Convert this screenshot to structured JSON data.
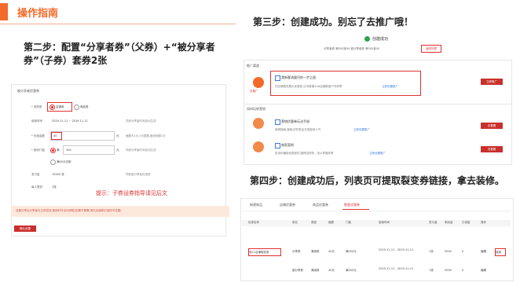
{
  "header": {
    "title": "操作指南"
  },
  "step2": {
    "text": "第二步：配置“分享者券”（父券）+“被分享者券”（子券）套券2张"
  },
  "left_form": {
    "title": "被分享者优惠券",
    "rows": [
      {
        "label": "* 券类型",
        "opt1": "店铺券",
        "opt2": "商品券"
      },
      {
        "label": "使用时间",
        "value": "2019-11-11 ~ 2019-11-11",
        "tip": "同到分享者时间自动生成"
      },
      {
        "label": "* 优惠金额",
        "value": "40",
        "unit": "元",
        "tip": "面额为1元,0元整数,最低面额1元"
      },
      {
        "label": "* 使用门槛",
        "opt1": "满",
        "value": "300",
        "unit": "元",
        "tip": "同到分享者时间自动生成"
      },
      {
        "label": "",
        "opt1": "满40元可用"
      },
      {
        "label": "发行量",
        "value": "15000 张",
        "tip": "同到被分享者优惠券"
      },
      {
        "label": "每人限领",
        "value": "1张"
      }
    ],
    "hint": "提示：子券设券指导请见后文",
    "warning": "设置分享后分享者可立即发放,使用时可自动领取(如果不需要,请在店铺券中选择不设置)",
    "submit": "确认设置"
  },
  "step3": {
    "text": "第三步：创建成功。别忘了去推广哦！"
  },
  "success": {
    "title": "创建成功",
    "line": "分享者券 满300减40   被分享者券 满300减40",
    "link": "返回列表"
  },
  "promo": {
    "section": "推广渠道",
    "bubble": "去推广",
    "card_title": "我新客流量归你一步之遥",
    "card_sub": "在店铺首页展示优惠券,日均新增10w店铺新用户可获享",
    "card_link": "立即设置推广",
    "btn": "立即推广"
  },
  "more": {
    "section": "如何玩转营销",
    "items": [
      {
        "title": "营销优惠券玩法手册",
        "sub": "使用指南,营销,好好发出去奖励你人气",
        "link": "立即设置推广",
        "btn": "去看看"
      },
      {
        "title": "商家案例",
        "sub": "告诉你通用优惠券的,做得这样的...怎么样做效率",
        "link": "立即设置推广",
        "btn": "去看看"
      }
    ]
  },
  "step4": {
    "text": "第四步：创建成功后，列表页可提取裂变券链接，拿去装修。"
  },
  "table": {
    "tabs": [
      "新建商品",
      "店铺优惠券",
      "商品优惠券",
      "裂变优惠券"
    ],
    "active_tab": 3,
    "headers": [
      "优惠名称",
      "券名",
      "类型",
      "面额",
      "门槛",
      "使用时间",
      "发行量",
      "剩余量",
      "已领量",
      "操作"
    ],
    "rows": [
      {
        "name": "双11店铺裂变券",
        "cells": [
          "分享券",
          "满减券",
          "40元",
          "满300元",
          "2019-11-11 - 2019-11-11",
          "1张",
          "5000",
          "0"
        ],
        "ops": [
          "编辑",
          "链接"
        ]
      },
      {
        "name": "",
        "cells": [
          "被分享券",
          "满减券",
          "40元",
          "满300元",
          "2019-11-11 - 2019-11-11",
          "1张",
          "5000",
          "0"
        ],
        "ops": [
          "编辑",
          ""
        ]
      }
    ]
  }
}
